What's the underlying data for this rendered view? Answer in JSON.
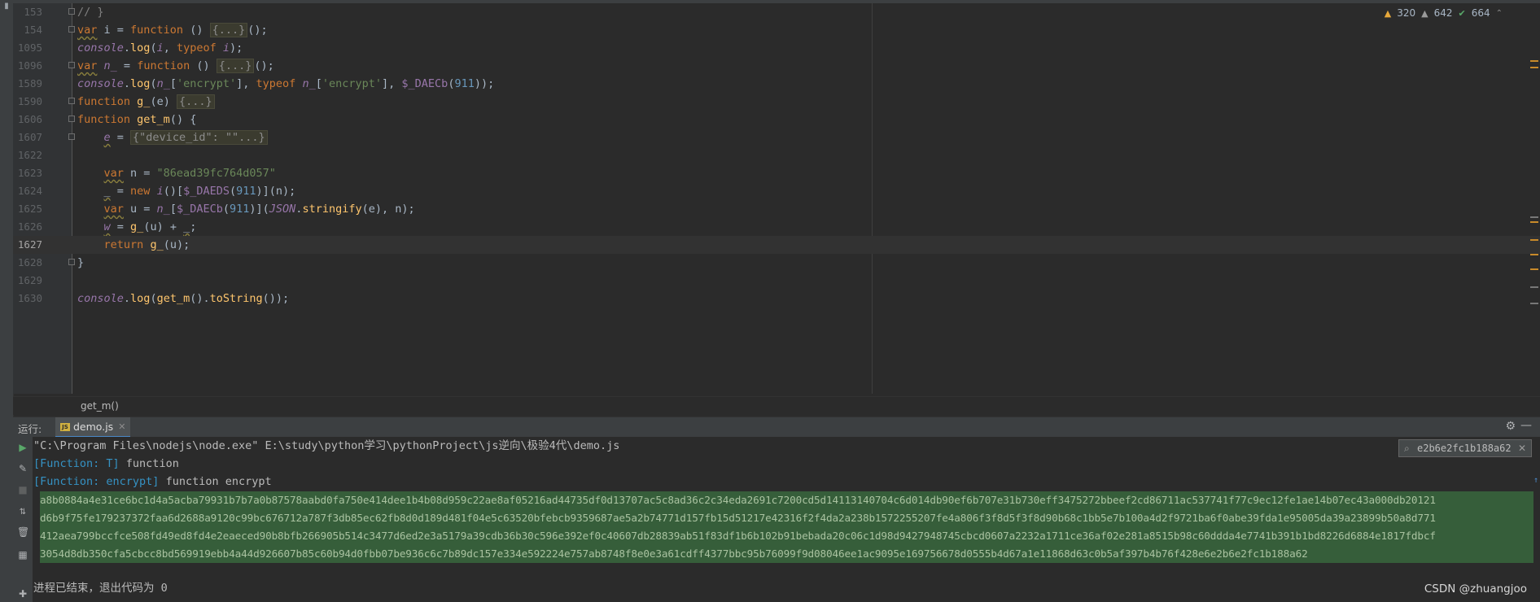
{
  "editor": {
    "inspections": {
      "warnings": "320",
      "weak_warnings": "642",
      "ok": "664"
    },
    "lines": [
      {
        "num": "153",
        "tokens": [
          {
            "t": "// }",
            "c": "cm"
          }
        ]
      },
      {
        "num": "154",
        "tokens": [
          {
            "t": "var",
            "c": "kw wavy"
          },
          {
            "t": " i = ",
            "c": "plain"
          },
          {
            "t": "function",
            "c": "kw"
          },
          {
            "t": " () ",
            "c": "plain"
          },
          {
            "t": "{...}",
            "c": "folded"
          },
          {
            "t": "();",
            "c": "plain"
          }
        ]
      },
      {
        "num": "1095",
        "tokens": [
          {
            "t": "console",
            "c": "it"
          },
          {
            "t": ".",
            "c": "plain"
          },
          {
            "t": "log",
            "c": "fn"
          },
          {
            "t": "(",
            "c": "plain"
          },
          {
            "t": "i",
            "c": "it"
          },
          {
            "t": ", ",
            "c": "plain"
          },
          {
            "t": "typeof",
            "c": "kw"
          },
          {
            "t": " ",
            "c": "plain"
          },
          {
            "t": "i",
            "c": "it"
          },
          {
            "t": ");",
            "c": "plain"
          }
        ]
      },
      {
        "num": "1096",
        "tokens": [
          {
            "t": "var",
            "c": "kw wavy"
          },
          {
            "t": " ",
            "c": "plain"
          },
          {
            "t": "n_",
            "c": "it"
          },
          {
            "t": " = ",
            "c": "plain"
          },
          {
            "t": "function",
            "c": "kw"
          },
          {
            "t": " () ",
            "c": "plain"
          },
          {
            "t": "{...}",
            "c": "folded"
          },
          {
            "t": "();",
            "c": "plain"
          }
        ]
      },
      {
        "num": "1589",
        "tokens": [
          {
            "t": "console",
            "c": "it"
          },
          {
            "t": ".",
            "c": "plain"
          },
          {
            "t": "log",
            "c": "fn"
          },
          {
            "t": "(",
            "c": "plain"
          },
          {
            "t": "n_",
            "c": "it"
          },
          {
            "t": "[",
            "c": "plain"
          },
          {
            "t": "'encrypt'",
            "c": "str"
          },
          {
            "t": "], ",
            "c": "plain"
          },
          {
            "t": "typeof",
            "c": "kw"
          },
          {
            "t": " ",
            "c": "plain"
          },
          {
            "t": "n_",
            "c": "it"
          },
          {
            "t": "[",
            "c": "plain"
          },
          {
            "t": "'encrypt'",
            "c": "str"
          },
          {
            "t": "], ",
            "c": "plain"
          },
          {
            "t": "$_DAECb",
            "c": "pur"
          },
          {
            "t": "(",
            "c": "plain"
          },
          {
            "t": "911",
            "c": "num"
          },
          {
            "t": "));",
            "c": "plain"
          }
        ]
      },
      {
        "num": "1590",
        "tokens": [
          {
            "t": "function",
            "c": "kw"
          },
          {
            "t": " ",
            "c": "plain"
          },
          {
            "t": "g_",
            "c": "fn"
          },
          {
            "t": "(e) ",
            "c": "plain"
          },
          {
            "t": "{...}",
            "c": "folded"
          }
        ]
      },
      {
        "num": "1606",
        "tokens": [
          {
            "t": "function",
            "c": "kw"
          },
          {
            "t": " ",
            "c": "plain"
          },
          {
            "t": "get_m",
            "c": "fn"
          },
          {
            "t": "() {",
            "c": "plain"
          }
        ]
      },
      {
        "num": "1607",
        "tokens": [
          {
            "t": "    ",
            "c": "plain"
          },
          {
            "t": "e",
            "c": "it wavy"
          },
          {
            "t": " = ",
            "c": "plain"
          },
          {
            "t": "{\"device_id\": \"\"...}",
            "c": "folded"
          }
        ]
      },
      {
        "num": "1622",
        "tokens": []
      },
      {
        "num": "1623",
        "tokens": [
          {
            "t": "    ",
            "c": "plain"
          },
          {
            "t": "var",
            "c": "kw wavy"
          },
          {
            "t": " n = ",
            "c": "plain"
          },
          {
            "t": "\"86ead39fc764d057\"",
            "c": "str"
          }
        ]
      },
      {
        "num": "1624",
        "tokens": [
          {
            "t": "    ",
            "c": "plain"
          },
          {
            "t": "_",
            "c": "plain wavy"
          },
          {
            "t": " = ",
            "c": "plain"
          },
          {
            "t": "new",
            "c": "kw"
          },
          {
            "t": " ",
            "c": "plain"
          },
          {
            "t": "i",
            "c": "it"
          },
          {
            "t": "()[",
            "c": "plain"
          },
          {
            "t": "$_DAEDS",
            "c": "pur"
          },
          {
            "t": "(",
            "c": "plain"
          },
          {
            "t": "911",
            "c": "num"
          },
          {
            "t": ")](n);",
            "c": "plain"
          }
        ]
      },
      {
        "num": "1625",
        "tokens": [
          {
            "t": "    ",
            "c": "plain"
          },
          {
            "t": "var",
            "c": "kw wavy"
          },
          {
            "t": " u = ",
            "c": "plain"
          },
          {
            "t": "n_",
            "c": "it"
          },
          {
            "t": "[",
            "c": "plain"
          },
          {
            "t": "$_DAECb",
            "c": "pur"
          },
          {
            "t": "(",
            "c": "plain"
          },
          {
            "t": "911",
            "c": "num"
          },
          {
            "t": ")](",
            "c": "plain"
          },
          {
            "t": "JSON",
            "c": "it"
          },
          {
            "t": ".",
            "c": "plain"
          },
          {
            "t": "stringify",
            "c": "fn"
          },
          {
            "t": "(e), n);",
            "c": "plain"
          }
        ]
      },
      {
        "num": "1626",
        "tokens": [
          {
            "t": "    ",
            "c": "plain"
          },
          {
            "t": "w",
            "c": "it wavy"
          },
          {
            "t": " = ",
            "c": "plain"
          },
          {
            "t": "g_",
            "c": "fn"
          },
          {
            "t": "(u) + ",
            "c": "plain"
          },
          {
            "t": "_",
            "c": "plain wavy"
          },
          {
            "t": ";",
            "c": "plain"
          }
        ]
      },
      {
        "num": "1627",
        "current": true,
        "tokens": [
          {
            "t": "    ",
            "c": "plain"
          },
          {
            "t": "return",
            "c": "kw"
          },
          {
            "t": " ",
            "c": "plain"
          },
          {
            "t": "g_",
            "c": "fn"
          },
          {
            "t": "(u);",
            "c": "plain"
          }
        ]
      },
      {
        "num": "1628",
        "tokens": [
          {
            "t": "}",
            "c": "plain"
          }
        ]
      },
      {
        "num": "1629",
        "tokens": []
      },
      {
        "num": "1630",
        "tokens": [
          {
            "t": "console",
            "c": "it"
          },
          {
            "t": ".",
            "c": "plain"
          },
          {
            "t": "log",
            "c": "fn"
          },
          {
            "t": "(",
            "c": "plain"
          },
          {
            "t": "get_m",
            "c": "fn"
          },
          {
            "t": "().",
            "c": "plain"
          },
          {
            "t": "toString",
            "c": "fn"
          },
          {
            "t": "());",
            "c": "plain"
          }
        ]
      }
    ]
  },
  "breadcrumb": "get_m()",
  "run": {
    "label": "运行:",
    "tab": "demo.js",
    "search_value": "e2b6e2fc1b188a62",
    "console": {
      "cmd": "\"C:\\Program Files\\nodejs\\node.exe\" E:\\study\\python学习\\pythonProject\\js逆向\\极验4代\\demo.js",
      "fn1_tag": "[Function: T]",
      "fn1_rest": " function",
      "fn2_tag": "[Function: encrypt]",
      "fn2_rest": " function encrypt",
      "output_lines": [
        "a8b0884a4e31ce6bc1d4a5acba79931b7b7a0b87578aabd0fa750e414dee1b4b08d959c22ae8af05216ad44735df0d13707ac5c8ad36c2c34eda2691c7200cd5d14113140704c6d014db90ef6b707e31b730eff3475272bbeef2cd86711ac537741f77c9ec12fe1ae14b07ec43a000db20121",
        "d6b9f75fe179237372faa6d2688a9120c99bc676712a787f3db85ec62fb8d0d189d481f04e5c63520bfebcb9359687ae5a2b74771d157fb15d51217e42316f2f4da2a238b1572255207fe4a806f3f8d5f3f8d90b68c1bb5e7b100a4d2f9721ba6f0abe39fda1e95005da39a23899b50a8d771",
        "412aea799bccfce508fd49ed8fd4e2eaeced90b8bfb266905b514c3477d6ed2e3a5179a39cdb36b30c596e392ef0c40607db28839ab51f83df1b6b102b91bebada20c06c1d98d9427948745cbcd0607a2232a1711ce36af02e281a8515b98c60ddda4e7741b391b1bd8226d6884e1817fdbcf",
        "3054d8db350cfa5cbcc8bd569919ebb4a44d926607b85c60b94d0fbb07be936c6c7b89dc157e334e592224e757ab8748f8e0e3a61cdff4377bbc95b76099f9d08046ee1ac9095e169756678d0555b4d67a1e11868d63c0b5af397b4b76f428e6e2b6e2fc1b188a62"
      ],
      "exit_msg": "进程已结束，退出代码为 0"
    }
  },
  "watermark": "CSDN @zhuangjoo"
}
